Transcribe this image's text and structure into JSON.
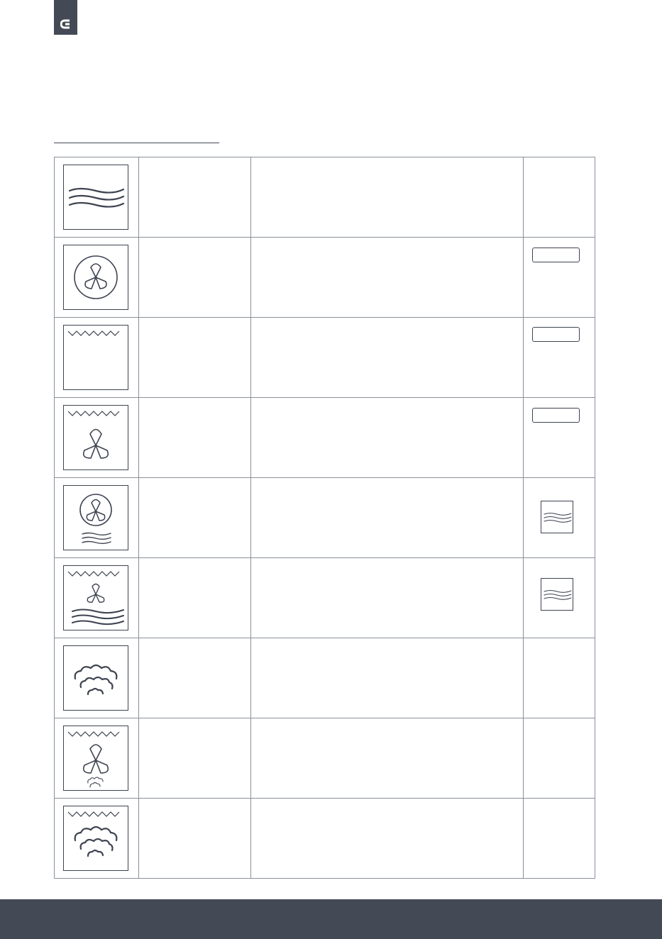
{
  "header": {
    "logo_icon": "brand-c-logo-icon",
    "accent_color": "#444a55"
  },
  "table": {
    "rows": [
      {
        "icon": "bottom-heat-waves-icon",
        "name": "",
        "description": "",
        "tag": "none"
      },
      {
        "icon": "ring-fan-icon",
        "name": "",
        "description": "",
        "tag": "pill-icon"
      },
      {
        "icon": "top-heat-icon",
        "name": "",
        "description": "",
        "tag": "pill-icon"
      },
      {
        "icon": "top-heat-fan-icon",
        "name": "",
        "description": "",
        "tag": "pill-icon"
      },
      {
        "icon": "ring-fan-bottom-heat-icon",
        "name": "",
        "description": "",
        "tag": "small-waves-icon"
      },
      {
        "icon": "top-fan-bottom-heat-icon",
        "name": "",
        "description": "",
        "tag": "small-waves-icon"
      },
      {
        "icon": "steam-icon",
        "name": "",
        "description": "",
        "tag": "none"
      },
      {
        "icon": "top-heat-fan-steam-icon",
        "name": "",
        "description": "",
        "tag": "none"
      },
      {
        "icon": "top-heat-steam-icon",
        "name": "",
        "description": "",
        "tag": "none"
      }
    ]
  },
  "footer": {
    "color": "#444a55"
  }
}
